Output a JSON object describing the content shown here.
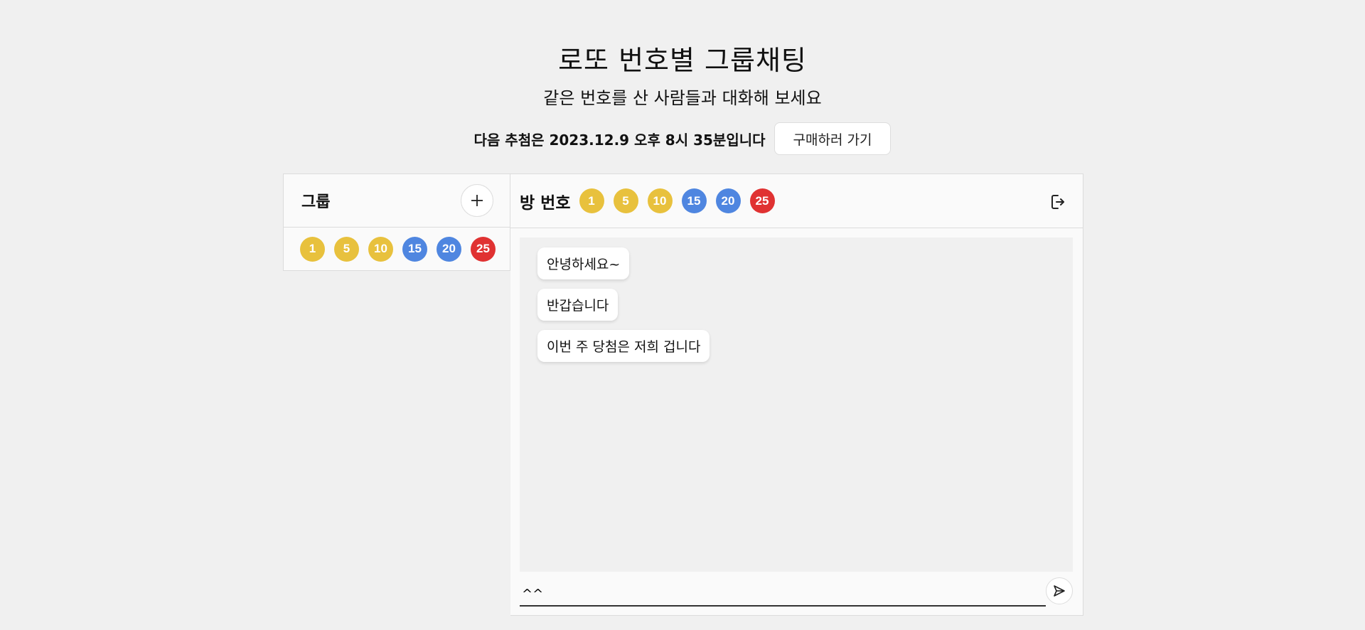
{
  "header": {
    "title": "로또 번호별 그룹채팅",
    "subtitle": "같은 번호를 산 사람들과 대화해 보세요",
    "draw_info": "다음 추첨은 2023.12.9 오후 8시 35분입니다",
    "buy_button_label": "구매하러 가기"
  },
  "sidebar": {
    "title": "그룹",
    "add_icon": "plus-icon",
    "groups": [
      {
        "numbers": [
          "1",
          "5",
          "10",
          "15",
          "20",
          "25"
        ]
      }
    ]
  },
  "chat": {
    "room_label": "방 번호",
    "room_numbers": [
      "1",
      "5",
      "10",
      "15",
      "20",
      "25"
    ],
    "exit_icon": "exit-icon",
    "messages": [
      {
        "text": "안녕하세요~"
      },
      {
        "text": "반갑습니다"
      },
      {
        "text": "이번 주 당첨은 저희 겁니다"
      }
    ],
    "input_value": "^^",
    "send_icon": "send-icon"
  },
  "colors": {
    "yellow": "#e8c13d",
    "blue": "#4f86e0",
    "red": "#e03232"
  }
}
